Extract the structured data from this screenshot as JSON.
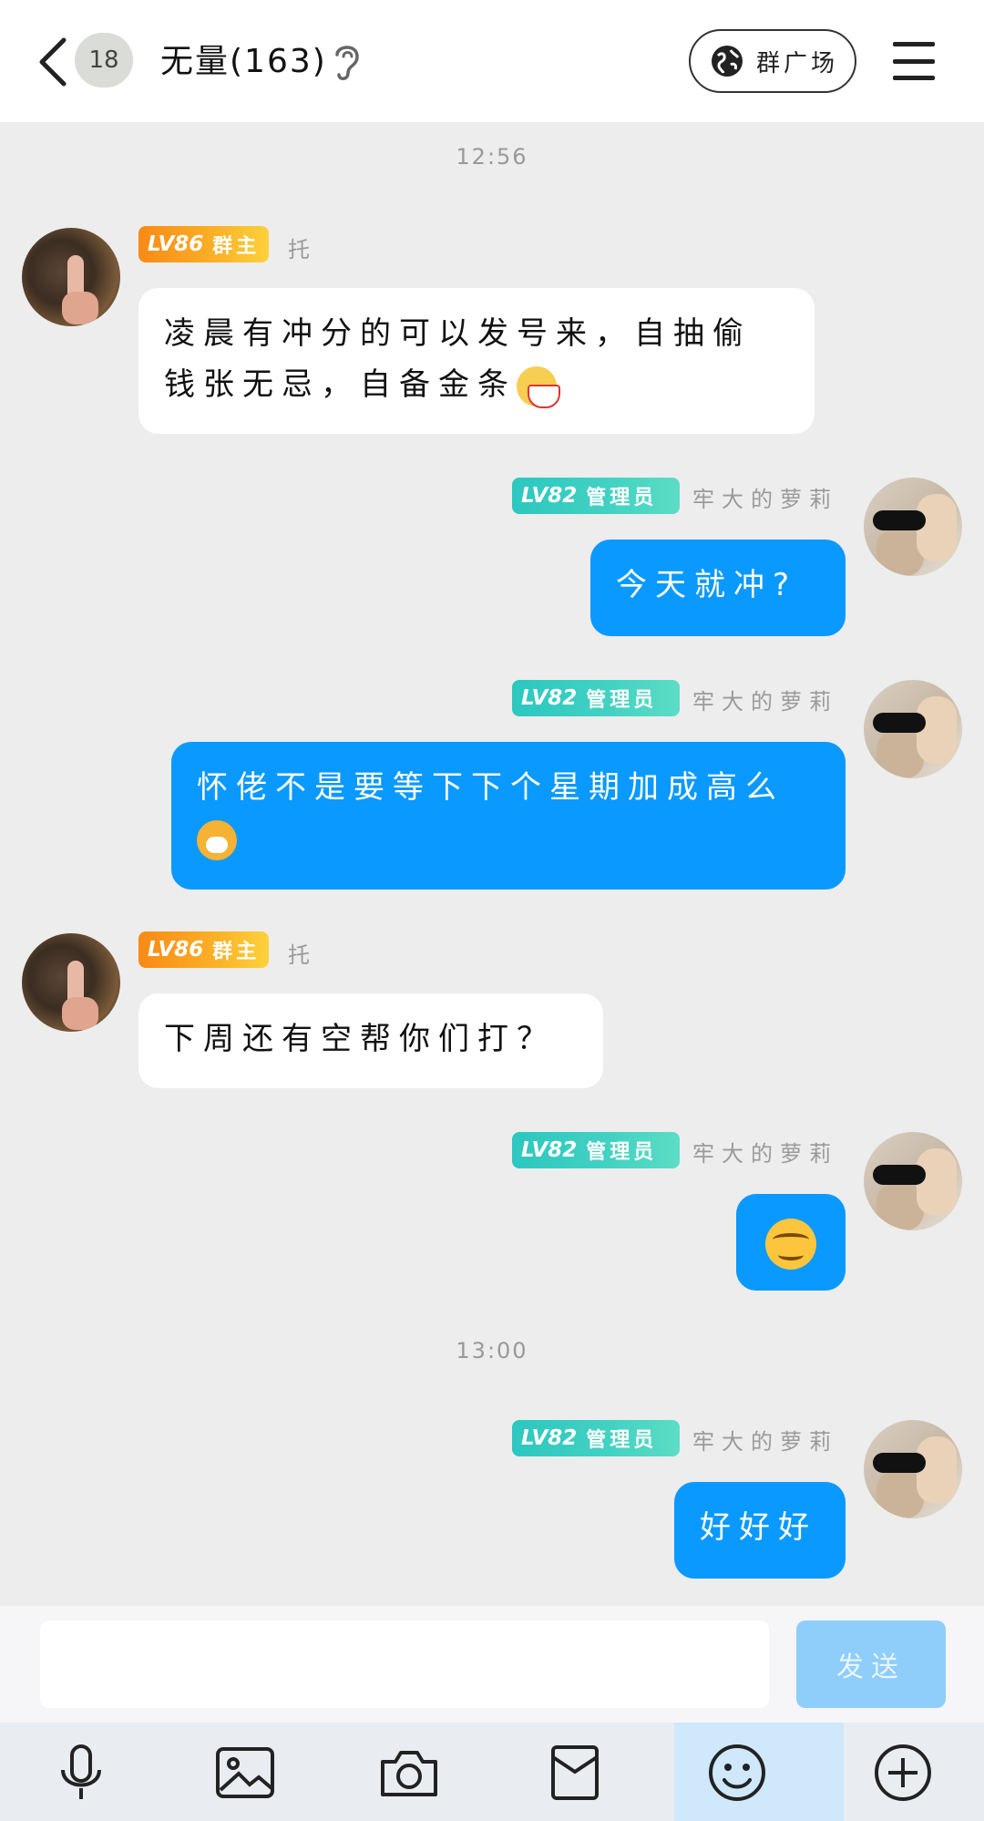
{
  "header": {
    "unread_count": "18",
    "title": "无量(163)",
    "plaza_label": "群广场"
  },
  "messages": [
    {
      "type": "time",
      "text": "12:56"
    },
    {
      "type": "in",
      "level": "LV86",
      "role": "群主",
      "nick": "托",
      "text": "凌晨有冲分的可以发号来，自抽偷钱张无忌，自备金条",
      "emoji": "fan-emoji"
    },
    {
      "type": "out",
      "level": "LV82",
      "role": "管理员",
      "nick": "牢大的萝莉",
      "text": "今天就冲?"
    },
    {
      "type": "out",
      "level": "LV82",
      "role": "管理员",
      "nick": "牢大的萝莉",
      "text": "怀佬不是要等下下个星期加成高么",
      "emoji": "tiger-emoji"
    },
    {
      "type": "in",
      "level": "LV86",
      "role": "群主",
      "nick": "托",
      "text": "下周还有空帮你们打？"
    },
    {
      "type": "out",
      "level": "LV82",
      "role": "管理员",
      "nick": "牢大的萝莉",
      "emoji": "smirk-emoji"
    },
    {
      "type": "time",
      "text": "13:00"
    },
    {
      "type": "out",
      "level": "LV82",
      "role": "管理员",
      "nick": "牢大的萝莉",
      "text": "好好好"
    }
  ],
  "input": {
    "placeholder": "",
    "send_label": "发送"
  },
  "toolbar": {
    "icons": [
      "microphone-icon",
      "image-icon",
      "camera-icon",
      "red-packet-icon",
      "emoji-icon",
      "plus-icon"
    ]
  },
  "colors": {
    "outgoing_bubble": "#0a99ff",
    "incoming_bubble": "#ffffff",
    "owner_badge": "#f88a15",
    "admin_badge": "#2cc7c0",
    "send_button": "#8fcdfb"
  }
}
